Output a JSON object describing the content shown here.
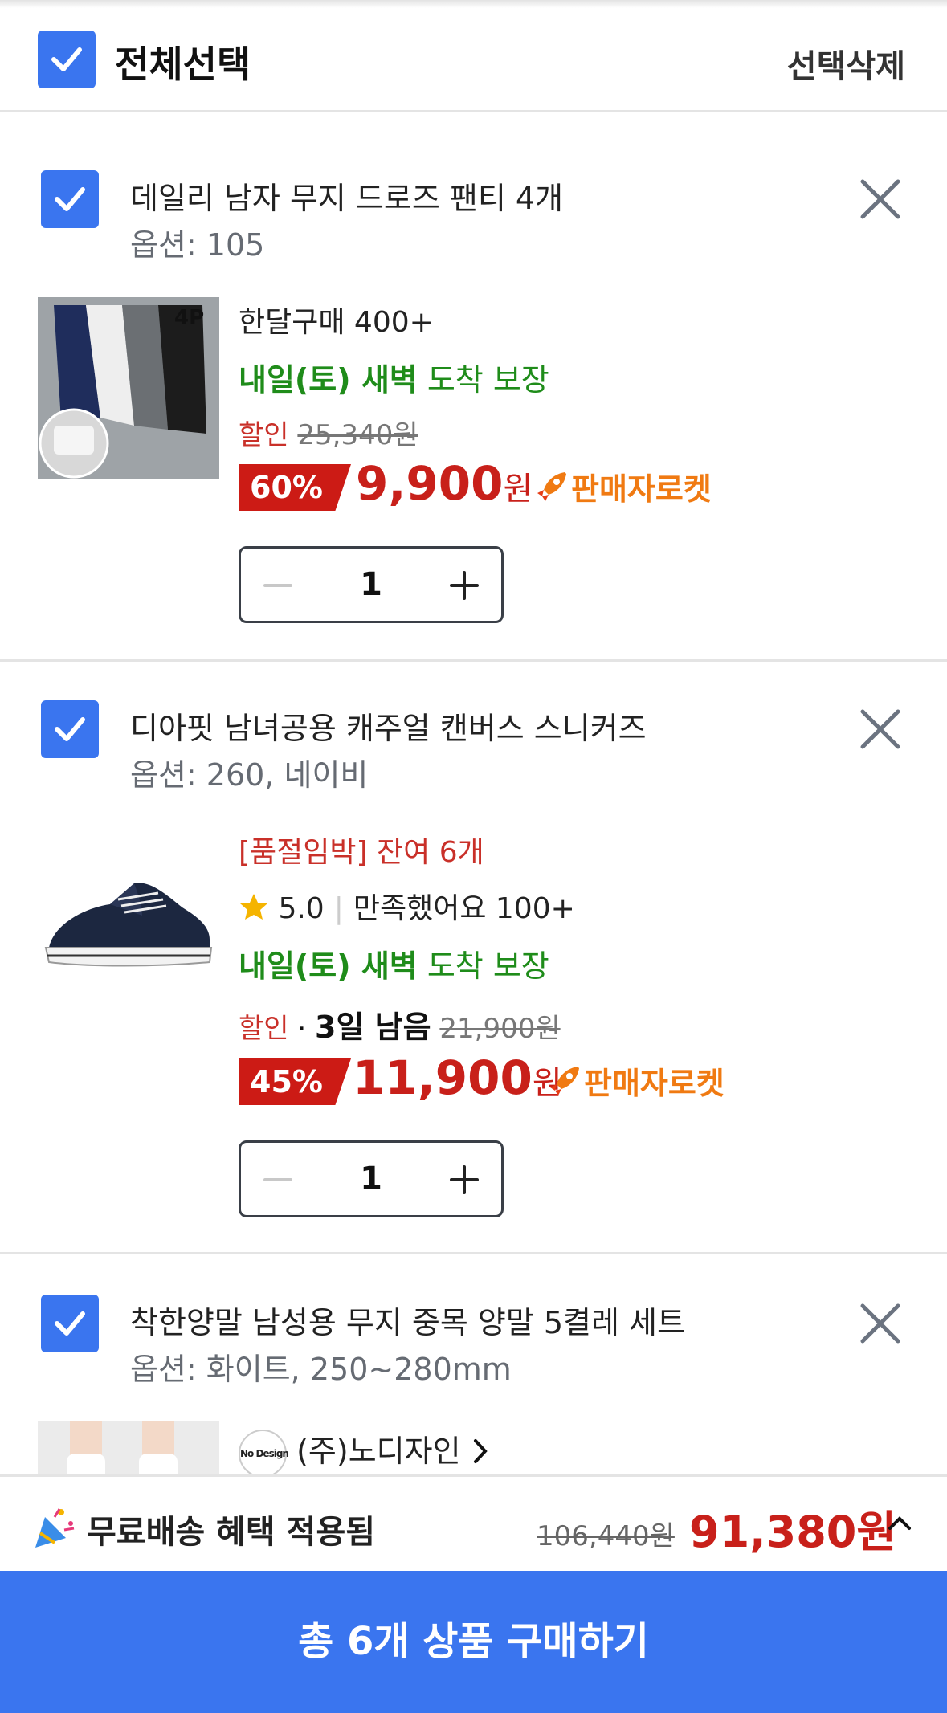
{
  "header": {
    "select_all_label": "전체선택",
    "delete_selected_label": "선택삭제"
  },
  "items": [
    {
      "name": "데일리 남자 무지 드로즈 팬티 4개",
      "option": "옵션: 105",
      "thumb_badge": "4P",
      "monthly_purchase": "한달구매 400+",
      "delivery_strong": "내일(토) 새벽",
      "delivery_rest": " 도착 보장",
      "discount_label": "할인",
      "original_price": "25,340원",
      "discount_percent": "60%",
      "price": "9,900",
      "currency": "원",
      "rocket_label": "판매자로켓",
      "quantity": "1"
    },
    {
      "name": "디아핏 남녀공용 캐주얼 캔버스 스니커즈",
      "option": "옵션: 260, 네이비",
      "stock_alert": "[품절임박] 잔여 6개",
      "rating": "5.0",
      "review_summary": "만족했어요 100+",
      "delivery_strong": "내일(토) 새벽",
      "delivery_rest": " 도착 보장",
      "discount_label": "할인",
      "time_left": "3일 남음",
      "original_price": "21,900원",
      "discount_percent": "45%",
      "price": "11,900",
      "currency": "원",
      "rocket_label": "판매자로켓",
      "quantity": "1"
    },
    {
      "name": "착한양말 남성용 무지 중목 양말 5켤레 세트",
      "option": "옵션: 화이트, 250~280mm",
      "seller_logo": "No Design",
      "seller_name": "(주)노디자인"
    }
  ],
  "summary": {
    "free_shipping": "무료배송 혜택 적용됨",
    "original_total": "106,440원",
    "total": "91,380원"
  },
  "buy_button_label": "총 6개 상품 구매하기",
  "colors": {
    "accent": "#3a75ef",
    "price_red": "#c8201a",
    "delivery_green": "#1f8c1a",
    "rocket_orange": "#f07a12"
  }
}
